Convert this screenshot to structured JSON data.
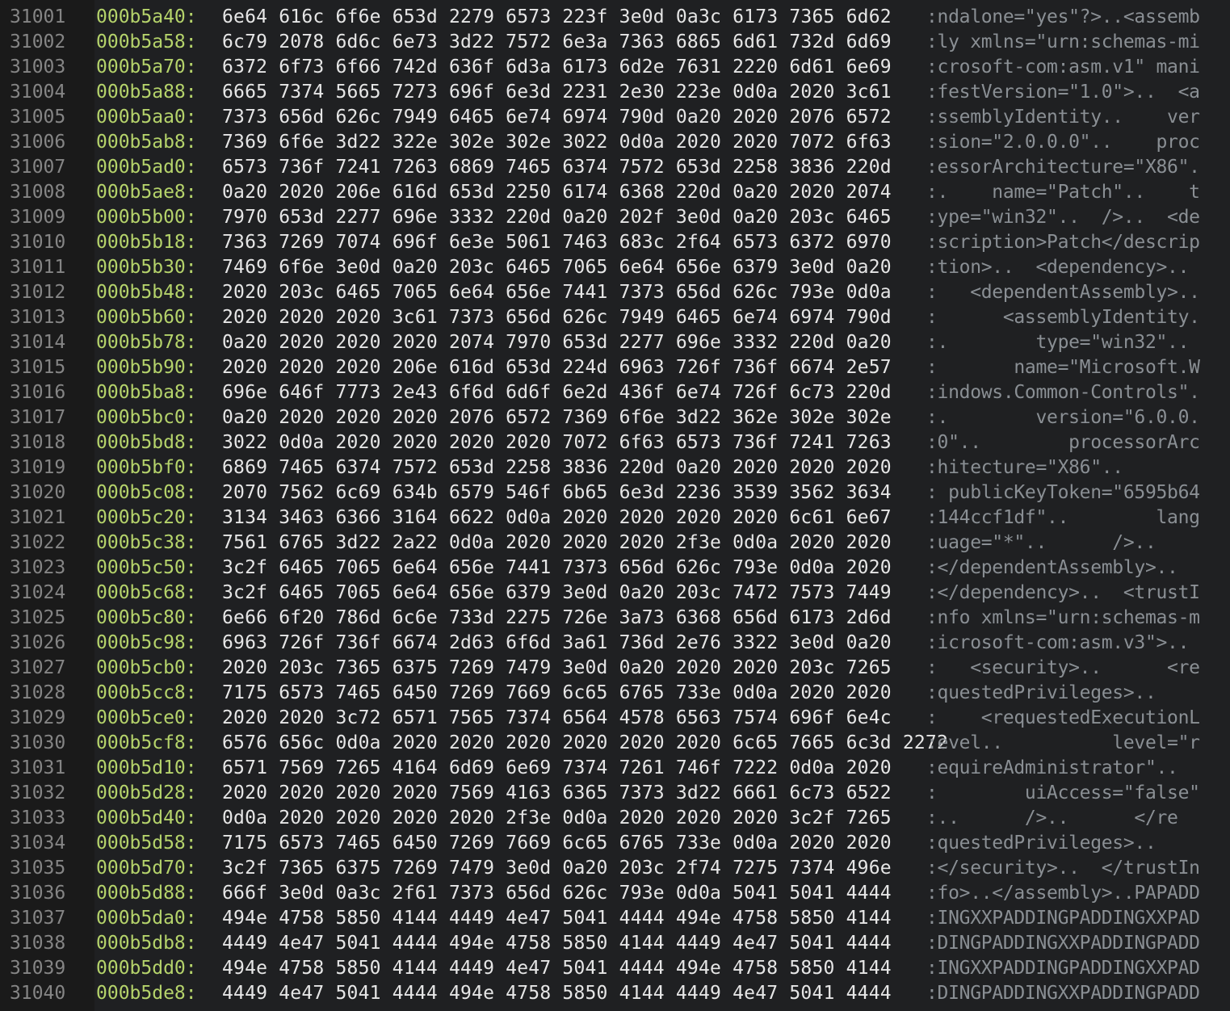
{
  "hexdump": {
    "rows": [
      {
        "line": "31001",
        "addr": "000b5a40:",
        "hex": "6e64 616c 6f6e 653d 2279 6573 223f 3e0d 0a3c 6173 7365 6d62",
        "ascii": ":ndalone=\"yes\"?>..<assemb"
      },
      {
        "line": "31002",
        "addr": "000b5a58:",
        "hex": "6c79 2078 6d6c 6e73 3d22 7572 6e3a 7363 6865 6d61 732d 6d69",
        "ascii": ":ly xmlns=\"urn:schemas-mi"
      },
      {
        "line": "31003",
        "addr": "000b5a70:",
        "hex": "6372 6f73 6f66 742d 636f 6d3a 6173 6d2e 7631 2220 6d61 6e69",
        "ascii": ":crosoft-com:asm.v1\" mani"
      },
      {
        "line": "31004",
        "addr": "000b5a88:",
        "hex": "6665 7374 5665 7273 696f 6e3d 2231 2e30 223e 0d0a 2020 3c61",
        "ascii": ":festVersion=\"1.0\">..  <a"
      },
      {
        "line": "31005",
        "addr": "000b5aa0:",
        "hex": "7373 656d 626c 7949 6465 6e74 6974 790d 0a20 2020 2076 6572",
        "ascii": ":ssemblyIdentity..    ver"
      },
      {
        "line": "31006",
        "addr": "000b5ab8:",
        "hex": "7369 6f6e 3d22 322e 302e 302e 3022 0d0a 2020 2020 7072 6f63",
        "ascii": ":sion=\"2.0.0.0\"..    proc"
      },
      {
        "line": "31007",
        "addr": "000b5ad0:",
        "hex": "6573 736f 7241 7263 6869 7465 6374 7572 653d 2258 3836 220d",
        "ascii": ":essorArchitecture=\"X86\"."
      },
      {
        "line": "31008",
        "addr": "000b5ae8:",
        "hex": "0a20 2020 206e 616d 653d 2250 6174 6368 220d 0a20 2020 2074",
        "ascii": ":.    name=\"Patch\"..    t"
      },
      {
        "line": "31009",
        "addr": "000b5b00:",
        "hex": "7970 653d 2277 696e 3332 220d 0a20 202f 3e0d 0a20 203c 6465",
        "ascii": ":ype=\"win32\"..  />..  <de"
      },
      {
        "line": "31010",
        "addr": "000b5b18:",
        "hex": "7363 7269 7074 696f 6e3e 5061 7463 683c 2f64 6573 6372 6970",
        "ascii": ":scription>Patch</descrip"
      },
      {
        "line": "31011",
        "addr": "000b5b30:",
        "hex": "7469 6f6e 3e0d 0a20 203c 6465 7065 6e64 656e 6379 3e0d 0a20",
        "ascii": ":tion>..  <dependency>.. "
      },
      {
        "line": "31012",
        "addr": "000b5b48:",
        "hex": "2020 203c 6465 7065 6e64 656e 7441 7373 656d 626c 793e 0d0a",
        "ascii": ":   <dependentAssembly>.."
      },
      {
        "line": "31013",
        "addr": "000b5b60:",
        "hex": "2020 2020 2020 3c61 7373 656d 626c 7949 6465 6e74 6974 790d",
        "ascii": ":      <assemblyIdentity."
      },
      {
        "line": "31014",
        "addr": "000b5b78:",
        "hex": "0a20 2020 2020 2020 2074 7970 653d 2277 696e 3332 220d 0a20",
        "ascii": ":.        type=\"win32\".. "
      },
      {
        "line": "31015",
        "addr": "000b5b90:",
        "hex": "2020 2020 2020 206e 616d 653d 224d 6963 726f 736f 6674 2e57",
        "ascii": ":       name=\"Microsoft.W"
      },
      {
        "line": "31016",
        "addr": "000b5ba8:",
        "hex": "696e 646f 7773 2e43 6f6d 6d6f 6e2d 436f 6e74 726f 6c73 220d",
        "ascii": ":indows.Common-Controls\"."
      },
      {
        "line": "31017",
        "addr": "000b5bc0:",
        "hex": "0a20 2020 2020 2020 2076 6572 7369 6f6e 3d22 362e 302e 302e",
        "ascii": ":.        version=\"6.0.0."
      },
      {
        "line": "31018",
        "addr": "000b5bd8:",
        "hex": "3022 0d0a 2020 2020 2020 2020 7072 6f63 6573 736f 7241 7263",
        "ascii": ":0\"..        processorArc"
      },
      {
        "line": "31019",
        "addr": "000b5bf0:",
        "hex": "6869 7465 6374 7572 653d 2258 3836 220d 0a20 2020 2020 2020",
        "ascii": ":hitecture=\"X86\"..       "
      },
      {
        "line": "31020",
        "addr": "000b5c08:",
        "hex": "2070 7562 6c69 634b 6579 546f 6b65 6e3d 2236 3539 3562 3634",
        "ascii": ": publicKeyToken=\"6595b64"
      },
      {
        "line": "31021",
        "addr": "000b5c20:",
        "hex": "3134 3463 6366 3164 6622 0d0a 2020 2020 2020 2020 6c61 6e67",
        "ascii": ":144ccf1df\"..        lang"
      },
      {
        "line": "31022",
        "addr": "000b5c38:",
        "hex": "7561 6765 3d22 2a22 0d0a 2020 2020 2020 2f3e 0d0a 2020 2020",
        "ascii": ":uage=\"*\"..      />..    "
      },
      {
        "line": "31023",
        "addr": "000b5c50:",
        "hex": "3c2f 6465 7065 6e64 656e 7441 7373 656d 626c 793e 0d0a 2020",
        "ascii": ":</dependentAssembly>..  "
      },
      {
        "line": "31024",
        "addr": "000b5c68:",
        "hex": "3c2f 6465 7065 6e64 656e 6379 3e0d 0a20 203c 7472 7573 7449",
        "ascii": ":</dependency>..  <trustI"
      },
      {
        "line": "31025",
        "addr": "000b5c80:",
        "hex": "6e66 6f20 786d 6c6e 733d 2275 726e 3a73 6368 656d 6173 2d6d",
        "ascii": ":nfo xmlns=\"urn:schemas-m"
      },
      {
        "line": "31026",
        "addr": "000b5c98:",
        "hex": "6963 726f 736f 6674 2d63 6f6d 3a61 736d 2e76 3322 3e0d 0a20",
        "ascii": ":icrosoft-com:asm.v3\">.. "
      },
      {
        "line": "31027",
        "addr": "000b5cb0:",
        "hex": "2020 203c 7365 6375 7269 7479 3e0d 0a20 2020 2020 203c 7265",
        "ascii": ":   <security>..      <re"
      },
      {
        "line": "31028",
        "addr": "000b5cc8:",
        "hex": "7175 6573 7465 6450 7269 7669 6c65 6765 733e 0d0a 2020 2020",
        "ascii": ":questedPrivileges>..    "
      },
      {
        "line": "31029",
        "addr": "000b5ce0:",
        "hex": "2020 2020 3c72 6571 7565 7374 6564 4578 6563 7574 696f 6e4c",
        "ascii": ":    <requestedExecutionL"
      },
      {
        "line": "31030",
        "addr": "000b5cf8:",
        "hex": "6576 656c 0d0a 2020 2020 2020 2020 2020 2020 6c65 7665 6c3d 2272",
        "ascii": ":evel..          level=\"r"
      },
      {
        "line": "31031",
        "addr": "000b5d10:",
        "hex": "6571 7569 7265 4164 6d69 6e69 7374 7261 746f 7222 0d0a 2020",
        "ascii": ":equireAdministrator\"..  "
      },
      {
        "line": "31032",
        "addr": "000b5d28:",
        "hex": "2020 2020 2020 2020 7569 4163 6365 7373 3d22 6661 6c73 6522",
        "ascii": ":        uiAccess=\"false\""
      },
      {
        "line": "31033",
        "addr": "000b5d40:",
        "hex": "0d0a 2020 2020 2020 2020 2f3e 0d0a 2020 2020 2020 3c2f 7265",
        "ascii": ":..      />..      </re"
      },
      {
        "line": "31034",
        "addr": "000b5d58:",
        "hex": "7175 6573 7465 6450 7269 7669 6c65 6765 733e 0d0a 2020 2020",
        "ascii": ":questedPrivileges>..    "
      },
      {
        "line": "31035",
        "addr": "000b5d70:",
        "hex": "3c2f 7365 6375 7269 7479 3e0d 0a20 203c 2f74 7275 7374 496e",
        "ascii": ":</security>..  </trustIn"
      },
      {
        "line": "31036",
        "addr": "000b5d88:",
        "hex": "666f 3e0d 0a3c 2f61 7373 656d 626c 793e 0d0a 5041 5041 4444",
        "ascii": ":fo>..</assembly>..PAPADD"
      },
      {
        "line": "31037",
        "addr": "000b5da0:",
        "hex": "494e 4758 5850 4144 4449 4e47 5041 4444 494e 4758 5850 4144",
        "ascii": ":INGXXPADDINGPADDINGXXPAD"
      },
      {
        "line": "31038",
        "addr": "000b5db8:",
        "hex": "4449 4e47 5041 4444 494e 4758 5850 4144 4449 4e47 5041 4444",
        "ascii": ":DINGPADDINGXXPADDINGPADD"
      },
      {
        "line": "31039",
        "addr": "000b5dd0:",
        "hex": "494e 4758 5850 4144 4449 4e47 5041 4444 494e 4758 5850 4144",
        "ascii": ":INGXXPADDINGPADDINGXXPAD"
      },
      {
        "line": "31040",
        "addr": "000b5de8:",
        "hex": "4449 4e47 5041 4444 494e 4758 5850 4144 4449 4e47 5041 4444",
        "ascii": ":DINGPADDINGXXPADDINGPADD"
      }
    ]
  },
  "colors": {
    "background": "#1e1e1e",
    "line_number": "#858585",
    "address": "#b5d36b",
    "hex": "#e6e6e6",
    "ascii": "#8a8f94"
  }
}
